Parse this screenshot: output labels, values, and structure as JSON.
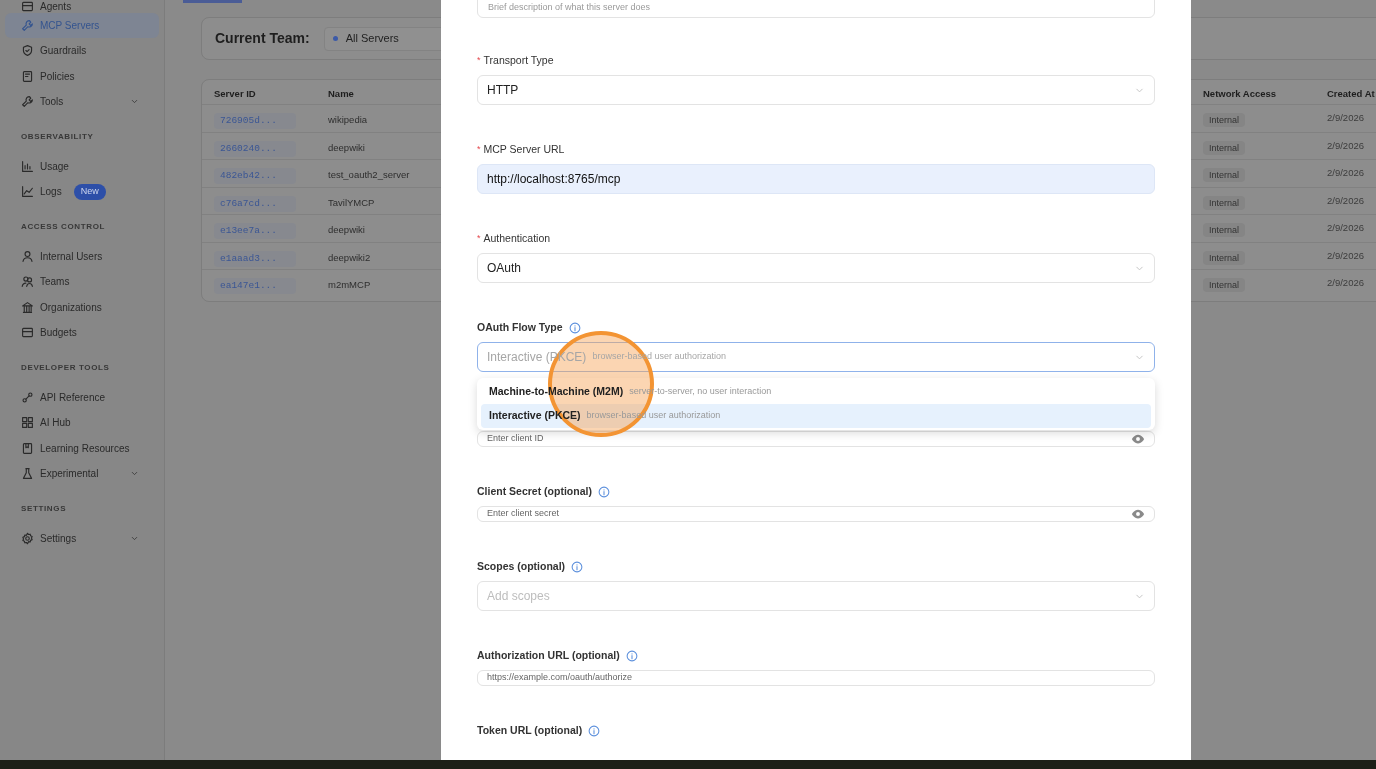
{
  "sidebar": {
    "sections": [
      {
        "items": [
          {
            "label": "Agents",
            "selected": false,
            "submenu": false
          },
          {
            "label": "MCP Servers",
            "selected": true,
            "submenu": false
          },
          {
            "label": "Guardrails",
            "selected": false,
            "submenu": false
          },
          {
            "label": "Policies",
            "selected": false,
            "submenu": false
          },
          {
            "label": "Tools",
            "selected": false,
            "submenu": true
          }
        ]
      },
      {
        "heading": "OBSERVABILITY",
        "items": [
          {
            "label": "Usage",
            "selected": false,
            "submenu": false
          },
          {
            "label": "Logs",
            "selected": false,
            "submenu": false,
            "badge": "New"
          }
        ]
      },
      {
        "heading": "ACCESS CONTROL",
        "items": [
          {
            "label": "Internal Users",
            "selected": false,
            "submenu": false
          },
          {
            "label": "Teams",
            "selected": false,
            "submenu": false
          },
          {
            "label": "Organizations",
            "selected": false,
            "submenu": false
          },
          {
            "label": "Budgets",
            "selected": false,
            "submenu": false
          }
        ]
      },
      {
        "heading": "DEVELOPER TOOLS",
        "items": [
          {
            "label": "API Reference",
            "selected": false,
            "submenu": false
          },
          {
            "label": "AI Hub",
            "selected": false,
            "submenu": false
          },
          {
            "label": "Learning Resources",
            "selected": false,
            "submenu": false
          },
          {
            "label": "Experimental",
            "selected": false,
            "submenu": true
          }
        ]
      },
      {
        "heading": "SETTINGS",
        "items": [
          {
            "label": "Settings",
            "selected": false,
            "submenu": true
          }
        ]
      }
    ]
  },
  "team_filter": {
    "label": "Current Team:",
    "value": "All Servers"
  },
  "table": {
    "columns": [
      "Server ID",
      "Name",
      "Network Access",
      "Created At"
    ],
    "rows": [
      {
        "server_id": "726905d...",
        "name": "wikipedia",
        "network_access": "Internal",
        "created_at": "2/9/2026"
      },
      {
        "server_id": "2660240...",
        "name": "deepwiki",
        "network_access": "Internal",
        "created_at": "2/9/2026"
      },
      {
        "server_id": "482eb42...",
        "name": "test_oauth2_server",
        "network_access": "Internal",
        "created_at": "2/9/2026"
      },
      {
        "server_id": "c76a7cd...",
        "name": "TavilYMCP",
        "network_access": "Internal",
        "created_at": "2/9/2026"
      },
      {
        "server_id": "e13ee7a...",
        "name": "deepwiki",
        "network_access": "Internal",
        "created_at": "2/9/2026"
      },
      {
        "server_id": "e1aaad3...",
        "name": "deepwiki2",
        "network_access": "Internal",
        "created_at": "2/9/2026"
      },
      {
        "server_id": "ea147e1...",
        "name": "m2mMCP",
        "network_access": "Internal",
        "created_at": "2/9/2026"
      }
    ]
  },
  "modal": {
    "description_field": {
      "placeholder": "Brief description of what this server does"
    },
    "fields": [
      {
        "kind": "select",
        "label": "Transport Type",
        "required_mark": "*",
        "value": "HTTP",
        "focused": false
      },
      {
        "kind": "input",
        "label": "MCP Server URL",
        "required_mark": "*",
        "value": "http://localhost:8765/mcp",
        "filled": true,
        "secret": false
      },
      {
        "kind": "select",
        "label": "Authentication",
        "required_mark": "*",
        "value": "OAuth",
        "focused": false
      },
      {
        "kind": "select",
        "label": "OAuth Flow Type",
        "info": true,
        "value": "Interactive (PKCE)",
        "value_note": "browser-based user authorization",
        "focused": true
      },
      {
        "kind": "input",
        "placeholder": "Enter client ID",
        "filled": false,
        "secret": true
      },
      {
        "kind": "input",
        "label": "Client Secret (optional)",
        "info": true,
        "placeholder": "Enter client secret",
        "filled": false,
        "secret": true
      },
      {
        "kind": "select",
        "label": "Scopes (optional)",
        "info": true,
        "placeholder": "Add scopes",
        "focused": false
      },
      {
        "kind": "input",
        "label": "Authorization URL (optional)",
        "info": true,
        "placeholder": "https://example.com/oauth/authorize",
        "filled": false,
        "secret": false
      },
      {
        "kind": "label",
        "label": "Token URL (optional)",
        "info": true
      }
    ],
    "dropdown": {
      "options": [
        {
          "label": "Machine-to-Machine (M2M)",
          "description": "server-to-server, no user interaction",
          "selected": false
        },
        {
          "label": "Interactive (PKCE)",
          "description": "browser-based user authorization",
          "selected": true
        }
      ]
    }
  }
}
